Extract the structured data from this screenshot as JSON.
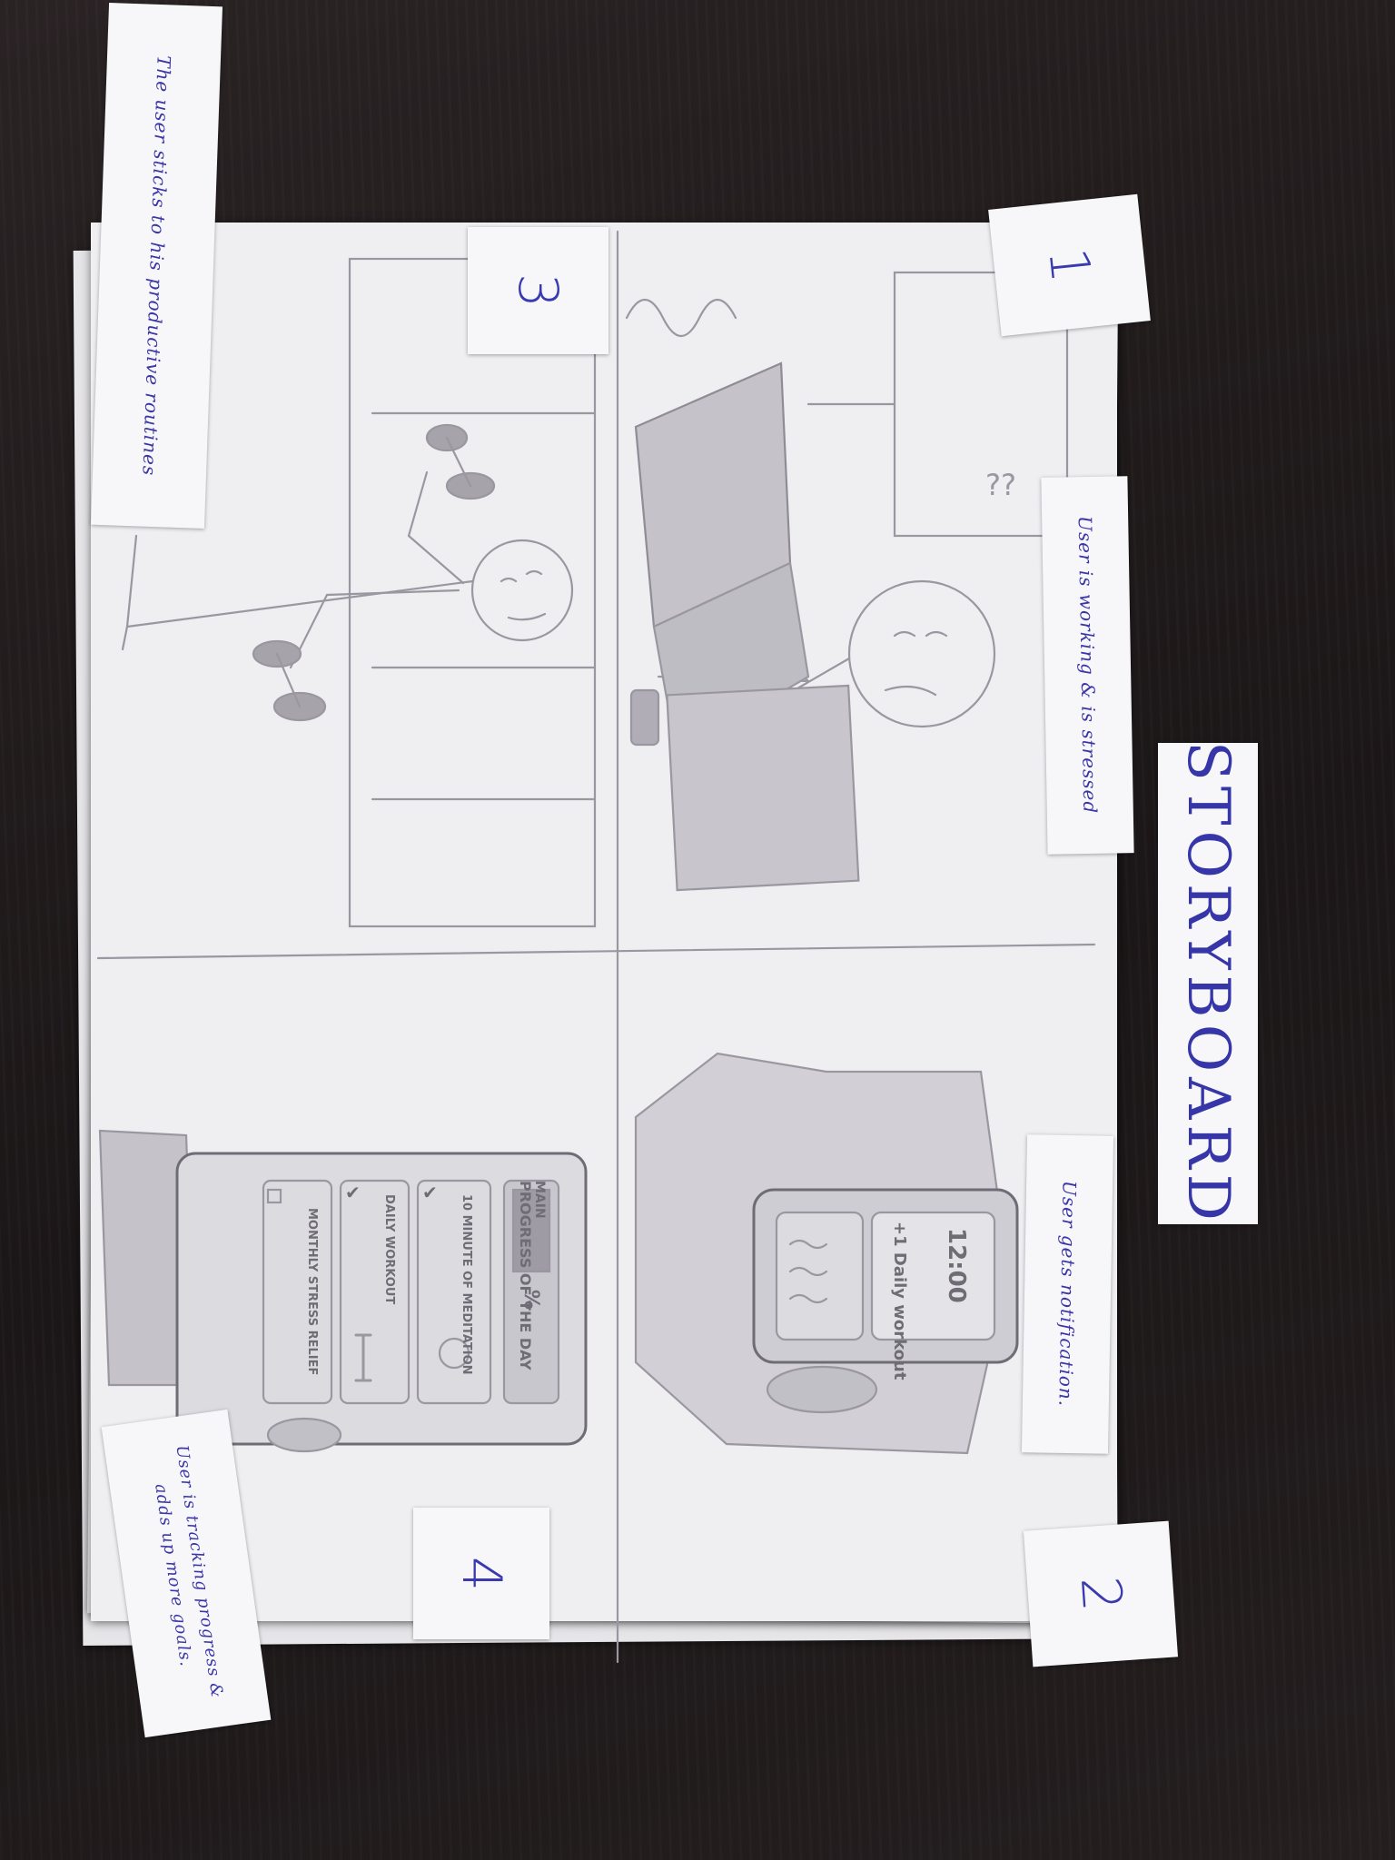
{
  "title": "STORYBOARD",
  "panels": [
    {
      "number": "1",
      "caption": "User is working & is stressed"
    },
    {
      "number": "2",
      "caption": "User gets notification."
    },
    {
      "number": "3",
      "caption": "The user sticks to his productive routines"
    },
    {
      "number": "4",
      "caption_line1": "User is tracking progress &",
      "caption_line2": "adds up more goals."
    }
  ],
  "phone_notification": {
    "time": "12:00",
    "message": "+1 Daily workout"
  },
  "app_screen": {
    "header_small": "MAIN",
    "header": "PROGRESS OF THE DAY",
    "progress_label": "%",
    "goals": [
      {
        "label": "10 MINUTE OF MEDITATION",
        "checked": true
      },
      {
        "label": "DAILY WORKOUT",
        "checked": true
      },
      {
        "label": "MONTHLY STRESS RELIEF",
        "checked": false
      }
    ]
  },
  "colors": {
    "ink": "#3a36a8",
    "pencil": "#8a878f",
    "paper": "#efeef1",
    "table": "#1f1a1b"
  }
}
